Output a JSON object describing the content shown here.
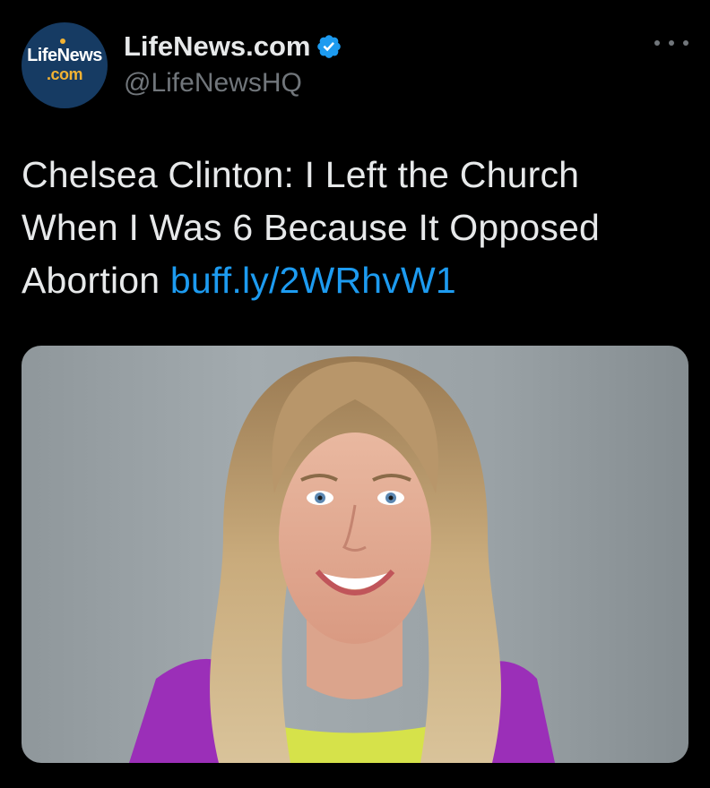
{
  "account": {
    "avatar_line1": "LifeNews",
    "avatar_line2": ".com",
    "display_name": "LifeNews.com",
    "handle": "@LifeNewsHQ",
    "verified_icon": "verified-badge-icon"
  },
  "tweet": {
    "text": "Chelsea Clinton: I Left the Church When I Was 6 Because It Opposed Abortion ",
    "link_text": "buff.ly/2WRhvW1"
  },
  "icons": {
    "more": "more-horizontal-icon"
  },
  "colors": {
    "background": "#000000",
    "primary_text": "#e7e9ea",
    "secondary_text": "#71767b",
    "link": "#1d9bf0",
    "verified": "#1d9bf0",
    "avatar_bg": "#163b63",
    "avatar_accent": "#f2b233"
  }
}
